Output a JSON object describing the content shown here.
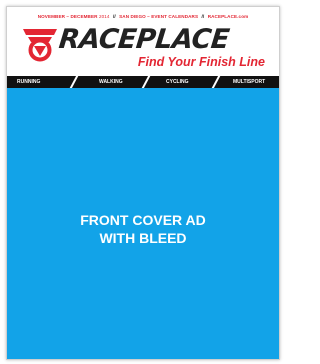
{
  "masthead": {
    "issue_dates": "NOVEMBER – DECEMBER",
    "issue_year": "2014",
    "issue_sep1": "//",
    "issue_city_events": "SAN DIEGO – EVENT CALENDARS",
    "issue_sep2": "//",
    "issue_site": "RACEPLACE.com",
    "logo_icon": "raceplace-shield-logo",
    "wordmark": "RACEPLACE",
    "tagline": "Find Your Finish Line"
  },
  "nav": {
    "items": [
      "RUNNING",
      "WALKING",
      "CYCLING",
      "MULTISPORT"
    ]
  },
  "ad": {
    "line1": "FRONT COVER AD",
    "line2": "WITH BLEED"
  },
  "colors": {
    "accent_red": "#e32633",
    "ad_blue": "#12a3e8",
    "nav_black": "#111111"
  }
}
